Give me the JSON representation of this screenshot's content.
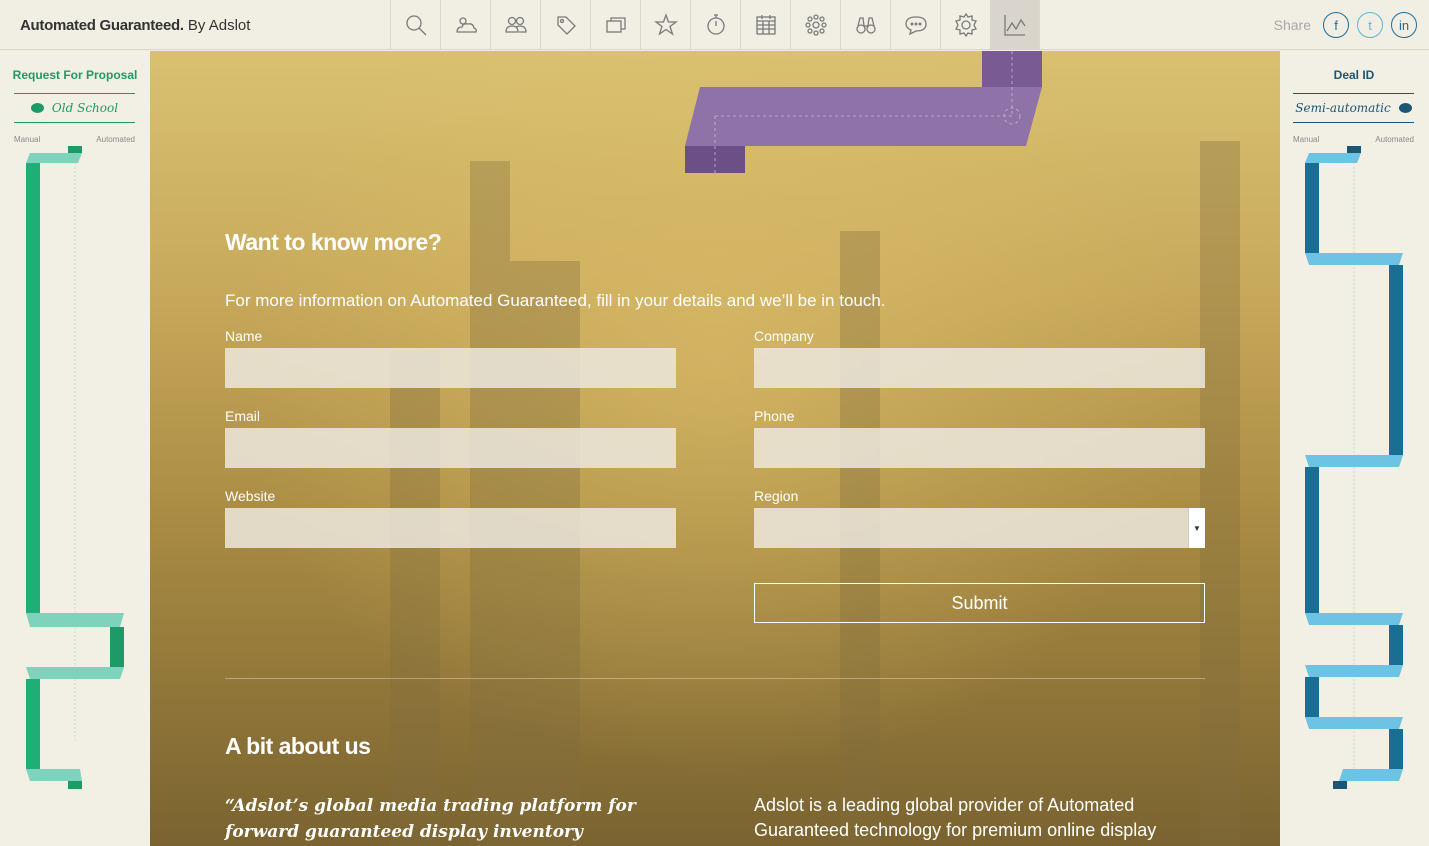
{
  "header": {
    "brand_bold": "Automated Guaranteed.",
    "brand_rest": "By Adslot",
    "nav_icons": [
      "search-icon",
      "weather-icon",
      "users-icon",
      "tag-icon",
      "screens-icon",
      "star-icon",
      "timer-icon",
      "calendar-icon",
      "network-icon",
      "binoculars-icon",
      "chat-icon",
      "settings-icon",
      "chart-icon"
    ],
    "active_icon": "chart-icon",
    "share_label": "Share",
    "social": {
      "facebook": "f",
      "twitter": "t",
      "linkedin": "in"
    }
  },
  "left_panel": {
    "title": "Request For Proposal",
    "subtitle": "Old School",
    "scale_min": "Manual",
    "scale_max": "Automated",
    "color": "#1e9a68"
  },
  "right_panel": {
    "title": "Deal ID",
    "subtitle": "Semi-automatic",
    "scale_min": "Manual",
    "scale_max": "Automated",
    "color": "#1b5675"
  },
  "form": {
    "title": "Want to know more?",
    "intro": "For more information on Automated Guaranteed, fill in your details and we’ll be in touch.",
    "name_label": "Name",
    "company_label": "Company",
    "email_label": "Email",
    "phone_label": "Phone",
    "website_label": "Website",
    "region_label": "Region",
    "submit_label": "Submit"
  },
  "about": {
    "title": "A bit about us",
    "quote": "“Adslot’s global media trading platform for forward guaranteed display inventory redresses endemic",
    "text": "Adslot is a leading global provider of Automated Guaranteed technology for premium online display"
  },
  "colors": {
    "accent_purple": "#8f73a8",
    "background_gold": "#c8a95b"
  }
}
